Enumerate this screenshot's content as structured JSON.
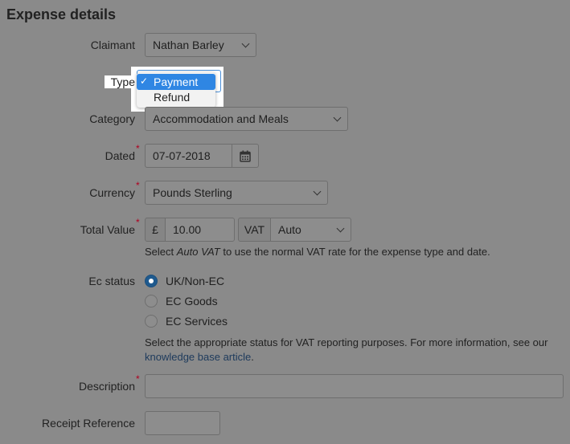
{
  "section_title": "Expense details",
  "claimant": {
    "label": "Claimant",
    "value": "Nathan Barley"
  },
  "type": {
    "label": "Type",
    "options": [
      {
        "check": "✓",
        "label": "Payment",
        "selected": true
      },
      {
        "check": "",
        "label": "Refund",
        "selected": false
      }
    ]
  },
  "category": {
    "label": "Category",
    "value": "Accommodation and Meals"
  },
  "dated": {
    "label": "Dated",
    "required": "*",
    "value": "07-07-2018",
    "icon": "calendar-icon"
  },
  "currency": {
    "label": "Currency",
    "required": "*",
    "value": "Pounds Sterling"
  },
  "total_value": {
    "label": "Total Value",
    "required": "*",
    "currency_symbol": "£",
    "amount": "10.00",
    "vat_label": "VAT",
    "vat_value": "Auto",
    "help_prefix": "Select ",
    "help_emphasis": "Auto VAT",
    "help_suffix": " to use the normal VAT rate for the expense type and date."
  },
  "ec_status": {
    "label": "Ec status",
    "options": [
      {
        "label": "UK/Non-EC",
        "checked": true
      },
      {
        "label": "EC Goods",
        "checked": false
      },
      {
        "label": "EC Services",
        "checked": false
      }
    ],
    "help_line1": "Select the appropriate status for VAT reporting purposes. For more information, see our",
    "help_link": "knowledge base article",
    "help_end": "."
  },
  "description": {
    "label": "Description",
    "required": "*",
    "value": ""
  },
  "receipt_reference": {
    "label": "Receipt Reference",
    "value": ""
  },
  "colors": {
    "overlay_background": "#8a8a8a",
    "selected_menu": "#2f86e3",
    "radio_on": "#1f5a8e",
    "required": "#b00020"
  }
}
